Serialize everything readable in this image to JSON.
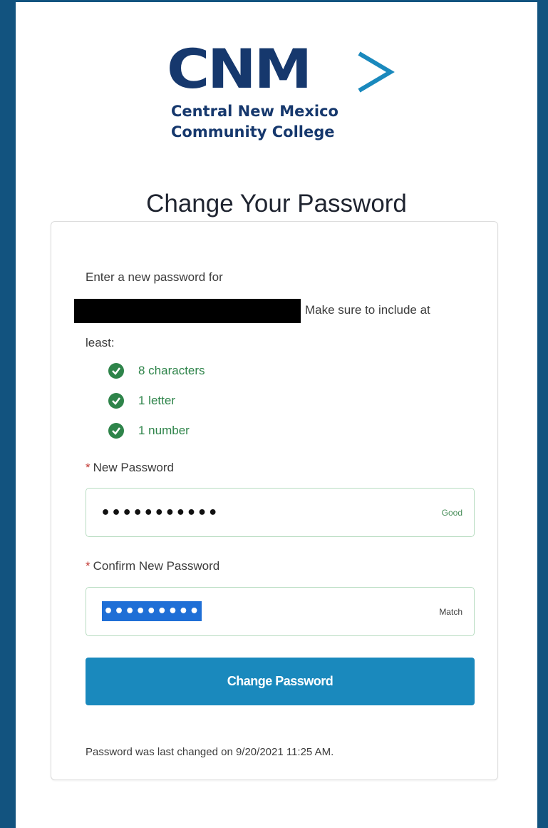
{
  "logo": {
    "wordmark": "CNM",
    "line1": "Central New Mexico",
    "line2": "Community College",
    "brand_color": "#16386d",
    "arrow_color": "#1a89bd"
  },
  "page_title": "Change Your Password",
  "intro": {
    "line1": "Enter a new password for",
    "line2_suffix": "Make sure to include at",
    "line3": "least:"
  },
  "requirements": [
    {
      "label": "8 characters",
      "icon": "check-circle-icon",
      "status": "met"
    },
    {
      "label": "1 letter",
      "icon": "check-circle-icon",
      "status": "met"
    },
    {
      "label": "1 number",
      "icon": "check-circle-icon",
      "status": "met"
    }
  ],
  "new_password": {
    "required_marker": "*",
    "label": "New Password",
    "value": "•••••••••••",
    "strength": "Good"
  },
  "confirm_password": {
    "required_marker": "*",
    "label": "Confirm New Password",
    "value": "•••••••••••",
    "status": "Match"
  },
  "submit_label": "Change Password",
  "last_changed": "Password was last changed on 9/20/2021 11:25 AM.",
  "colors": {
    "background": "#12537f",
    "success": "#2e844a",
    "button": "#1a89bd",
    "required": "#c23934"
  }
}
